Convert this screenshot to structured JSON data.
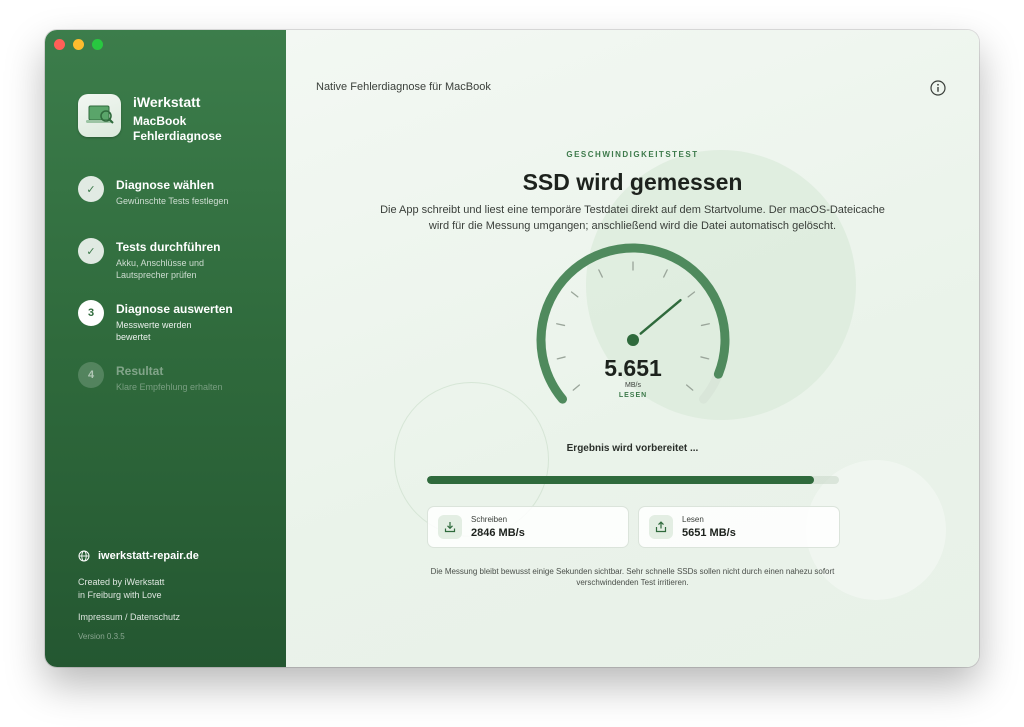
{
  "sidebar": {
    "brand": {
      "name": "iWerkstatt",
      "subtitle": "MacBook Fehlerdiagnose"
    },
    "steps": [
      {
        "state": "done",
        "marker": "✓",
        "title": "Diagnose wählen",
        "subtitle": "Gewünschte Tests festlegen"
      },
      {
        "state": "done",
        "marker": "✓",
        "title": "Tests durchführen",
        "subtitle": "Akku, Anschlüsse und Lautsprecher prüfen"
      },
      {
        "state": "active",
        "marker": "3",
        "title": "Diagnose auswerten",
        "subtitle": "Messwerte werden bewertet"
      },
      {
        "state": "todo",
        "marker": "4",
        "title": "Resultat",
        "subtitle": "Klare Empfehlung erhalten"
      }
    ],
    "website": "iwerkstatt-repair.de",
    "credits_line1": "Created by iWerkstatt",
    "credits_line2": "in Freiburg with Love",
    "legal": "Impressum / Datenschutz",
    "version": "Version 0.3.5"
  },
  "main": {
    "top_title": "Native Fehlerdiagnose für MacBook",
    "kicker": "GESCHWINDIGKEITSTEST",
    "headline": "SSD wird gemessen",
    "description": "Die App schreibt und liest eine temporäre Testdatei direkt auf dem Startvolume. Der macOS-Dateicache wird für die Messung umgangen; anschließend wird die Datei automatisch gelöscht.",
    "gauge": {
      "value": "5.651",
      "unit": "MB/s",
      "mode": "LESEN",
      "fill_fraction": 0.93
    },
    "status": "Ergebnis wird vorbereitet ...",
    "progress_fraction": 0.94,
    "cards": {
      "write": {
        "label": "Schreiben",
        "value": "2846 MB/s"
      },
      "read": {
        "label": "Lesen",
        "value": "5651 MB/s"
      }
    },
    "footnote": "Die Messung bleibt bewusst einige Sekunden sichtbar. Sehr schnelle SSDs sollen nicht durch einen nahezu sofort verschwindenden Test irritieren."
  },
  "colors": {
    "accent": "#2f6a3c",
    "sidebar": "#2f6a3c",
    "gauge_track": "#d9e6d9"
  },
  "icons": {
    "info": "info-icon",
    "globe": "globe-icon",
    "write": "download-icon",
    "read": "upload-icon"
  }
}
